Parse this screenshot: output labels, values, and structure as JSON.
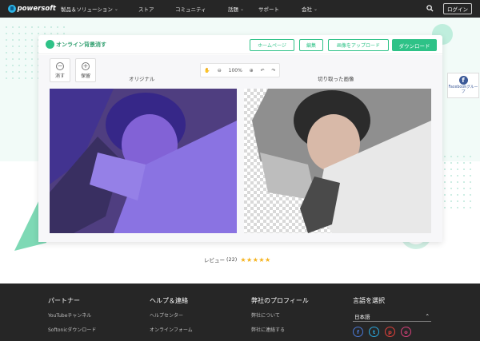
{
  "nav": {
    "logo": "powersoft",
    "items": [
      "製品＆ソリューション",
      "ストア",
      "コミュニティ",
      "話題",
      "サポート",
      "会社"
    ],
    "login": "ログイン"
  },
  "app": {
    "title": "オンライン背景消す",
    "buttons": {
      "home": "ホームページ",
      "edit": "編集",
      "upload": "画像をアップロード",
      "download": "ダウンロード"
    },
    "tools": {
      "erase": "消す",
      "keep": "保留"
    },
    "zoom": "100%",
    "original_label": "オリジナル",
    "cutout_label": "切り取った画像"
  },
  "side_badge": {
    "label": "Facebookグループ"
  },
  "review": {
    "text": "レビュー",
    "count": "(22)",
    "stars": "★★★★★"
  },
  "footer": {
    "partner": {
      "title": "パートナー",
      "links": [
        "YouTubeチャンネル",
        "Softonicダウンロード"
      ]
    },
    "help": {
      "title": "ヘルプ＆連絡",
      "links": [
        "ヘルプセンター",
        "オンラインフォーム"
      ]
    },
    "profile": {
      "title": "弊社のプロフィール",
      "links": [
        "弊社について",
        "弊社に連絡する"
      ]
    },
    "language": {
      "title": "言語を選択",
      "selected": "日本語",
      "socials": [
        "f",
        "t",
        "p",
        "o"
      ]
    }
  },
  "colors": {
    "accent": "#2ec287",
    "nav_bg": "#262626",
    "footer_bg": "#262626",
    "mask": "#5a3fd6"
  }
}
